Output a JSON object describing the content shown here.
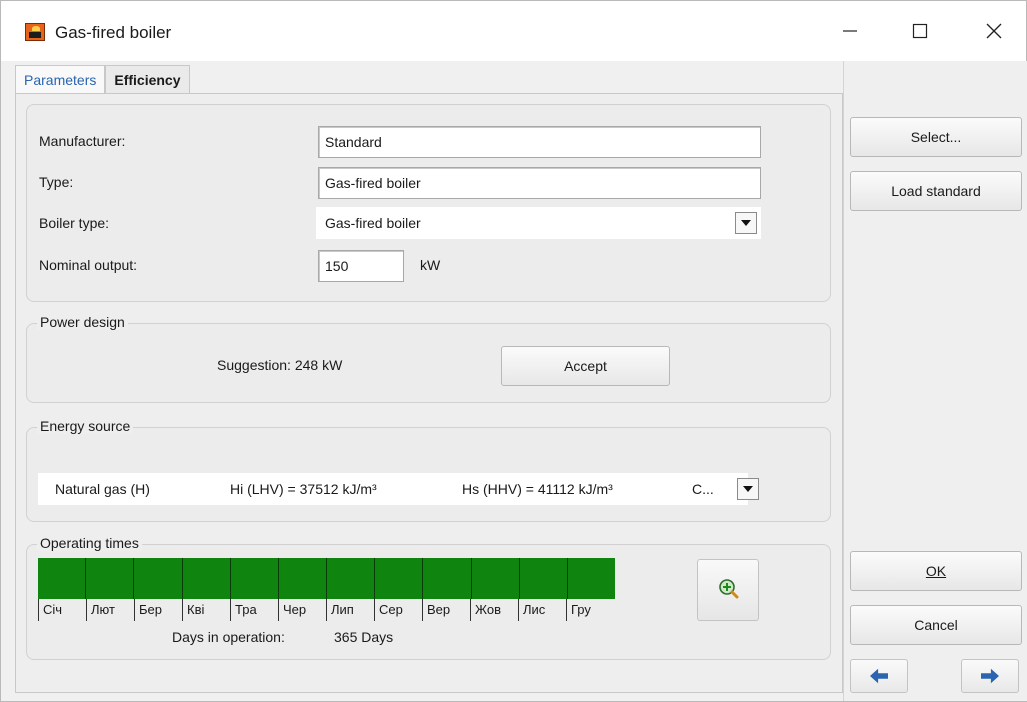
{
  "window": {
    "title": "Gas-fired boiler"
  },
  "tabs": [
    {
      "label": "Parameters",
      "active": true
    },
    {
      "label": "Efficiency",
      "active": false
    }
  ],
  "parameters": {
    "manufacturer_label": "Manufacturer:",
    "manufacturer_value": "Standard",
    "type_label": "Type:",
    "type_value": "Gas-fired boiler",
    "boiler_type_label": "Boiler type:",
    "boiler_type_value": "Gas-fired boiler",
    "nominal_output_label": "Nominal output:",
    "nominal_output_value": "150",
    "nominal_output_unit": "kW"
  },
  "power_design": {
    "title": "Power design",
    "suggestion": "Suggestion: 248 kW",
    "accept_label": "Accept"
  },
  "energy_source": {
    "title": "Energy source",
    "name": "Natural gas (H)",
    "hi": "Hi (LHV) = 37512 kJ/m³",
    "hs": "Hs (HHV) = 41112 kJ/m³",
    "more": "C..."
  },
  "operating_times": {
    "title": "Operating times",
    "months": [
      "Січ",
      "Лют",
      "Бер",
      "Кві",
      "Тра",
      "Чер",
      "Лип",
      "Сер",
      "Вер",
      "Жов",
      "Лис",
      "Гру"
    ],
    "days_label": "Days in operation:",
    "days_value": "365 Days",
    "bar_color": "#0f840f"
  },
  "side_buttons": {
    "select_label": "Select...",
    "load_standard_label": "Load standard",
    "ok_label": "OK",
    "cancel_label": "Cancel"
  },
  "icons": {
    "app": "boiler-icon",
    "zoom": "zoom-in-icon",
    "back": "arrow-left-icon",
    "forward": "arrow-right-icon"
  },
  "colors": {
    "accent": "#2a64b0",
    "arrow": "#2a64b0"
  }
}
